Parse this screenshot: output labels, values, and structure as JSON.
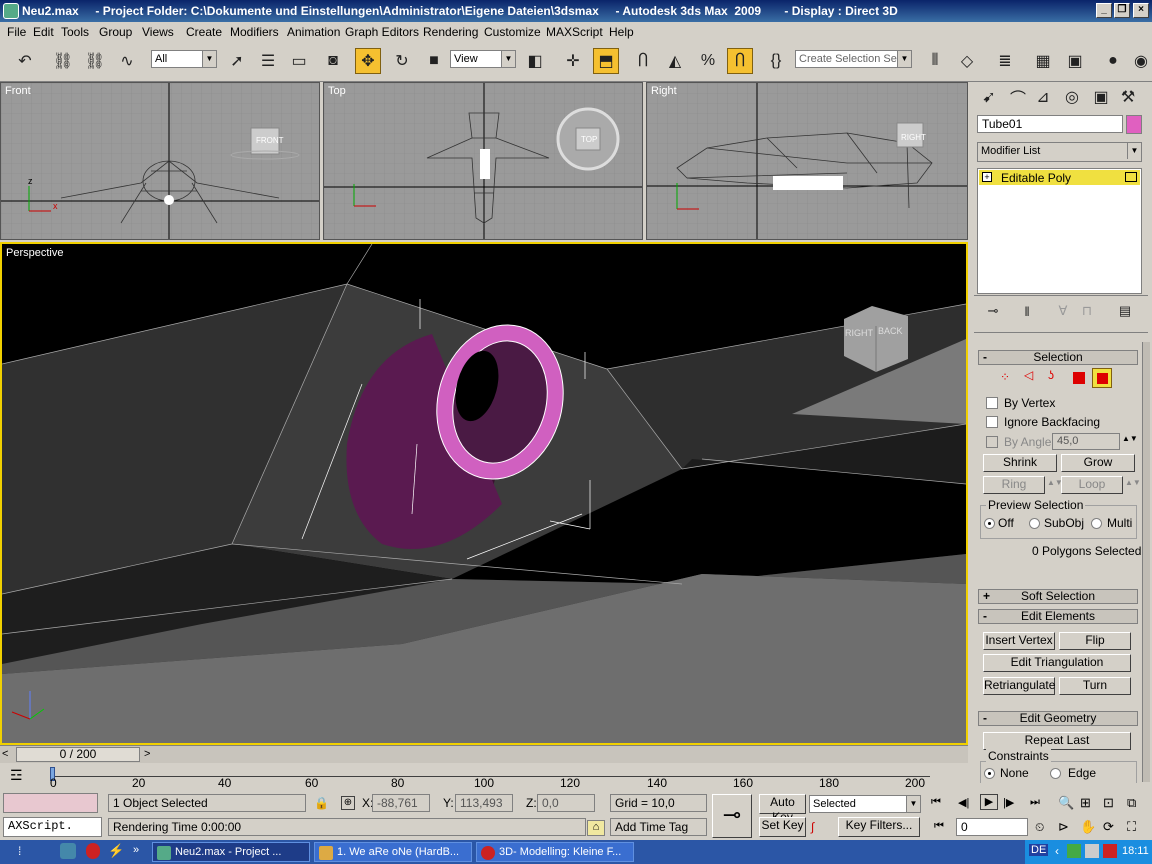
{
  "window": {
    "title": "Neu2.max     - Project Folder: C:\\Dokumente und Einstellungen\\Administrator\\Eigene Dateien\\3dsmax     - Autodesk 3ds Max  2009       - Display : Direct 3D",
    "minimize": "_",
    "maximize": "❐",
    "close": "×"
  },
  "menu": [
    "File",
    "Edit",
    "Tools",
    "Group",
    "Views",
    "Create",
    "Modifiers",
    "Animation",
    "Graph Editors",
    "Rendering",
    "Customize",
    "MAXScript",
    "Help"
  ],
  "toolbar": {
    "filter": "All",
    "ref_coord": "View",
    "selection_set": "Create Selection Set"
  },
  "viewports": {
    "front": "Front",
    "top": "Top",
    "right": "Right",
    "perspective": "Perspective",
    "cube_front": "FRONT",
    "cube_top": "TOP",
    "cube_right": "RIGHT",
    "cube_persp_a": "RIGHT",
    "cube_persp_b": "BACK"
  },
  "cmd": {
    "object_name": "Tube01",
    "object_color": "#e060c0",
    "modifier_list": "Modifier List",
    "stack_item": "Editable Poly",
    "selection": {
      "title": "Selection",
      "by_vertex": "By Vertex",
      "ignore_backfacing": "Ignore Backfacing",
      "by_angle": "By Angle:",
      "angle_value": "45,0",
      "shrink": "Shrink",
      "grow": "Grow",
      "ring": "Ring",
      "loop": "Loop",
      "preview_title": "Preview Selection",
      "off": "Off",
      "subobj": "SubObj",
      "multi": "Multi",
      "status": "0 Polygons Selected"
    },
    "soft_selection": "Soft Selection",
    "edit_elements": {
      "title": "Edit Elements",
      "insert_vertex": "Insert Vertex",
      "flip": "Flip",
      "edit_triangulation": "Edit Triangulation",
      "retriangulate": "Retriangulate",
      "turn": "Turn"
    },
    "edit_geometry": {
      "title": "Edit Geometry",
      "repeat_last": "Repeat Last",
      "constraints": "Constraints",
      "none": "None",
      "edge": "Edge"
    }
  },
  "timeline": {
    "frame": "0 / 200",
    "ticks": [
      "0",
      "20",
      "40",
      "60",
      "80",
      "100",
      "120",
      "140",
      "160",
      "180",
      "200"
    ]
  },
  "status": {
    "maxscript": "AXScript.",
    "selected": "1 Object Selected",
    "render_time": "Rendering Time  0:00:00",
    "x_label": "X:",
    "x": "-88,761",
    "y_label": "Y:",
    "y": "113,493",
    "z_label": "Z:",
    "z": "0,0",
    "grid": "Grid = 10,0",
    "add_time_tag": "Add Time Tag",
    "auto_key": "Auto Key",
    "set_key": "Set Key",
    "key_mode": "Selected",
    "key_filters": "Key Filters...",
    "current_frame": "0"
  },
  "taskbar": {
    "items": [
      "Neu2.max     - Project ...",
      "1. We aRe oNe (HardB...",
      "3D- Modelling: Kleine F..."
    ],
    "lang": "DE",
    "clock": "18:11"
  }
}
